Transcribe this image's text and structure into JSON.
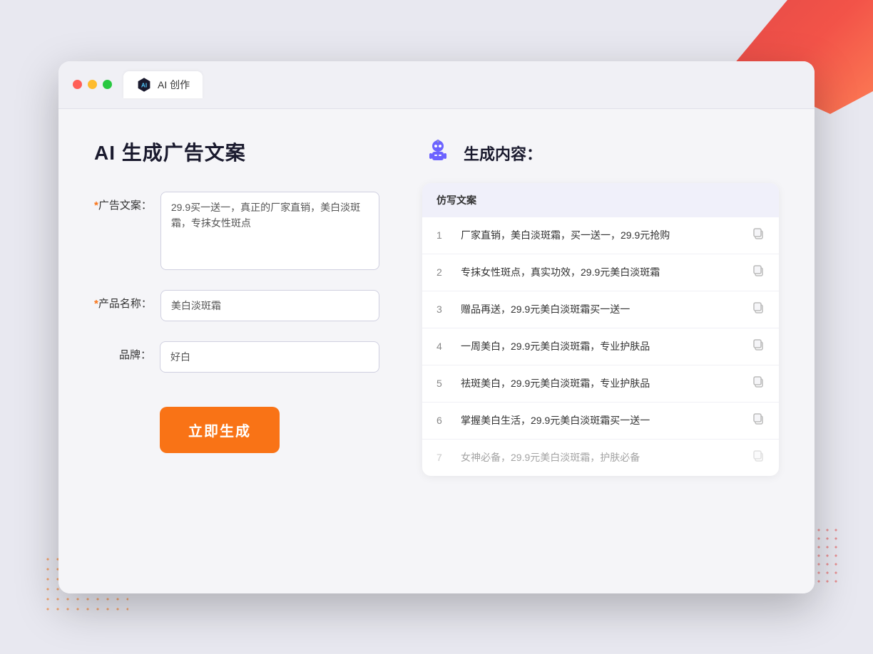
{
  "window": {
    "tab_label": "AI 创作"
  },
  "page": {
    "title": "AI 生成广告文案",
    "form": {
      "ad_copy_label": "广告文案：",
      "ad_copy_required": "*",
      "ad_copy_value": "29.9买一送一，真正的厂家直销，美白淡斑霜，专抹女性斑点",
      "product_name_label": "产品名称：",
      "product_name_required": "*",
      "product_name_value": "美白淡斑霜",
      "brand_label": "品牌：",
      "brand_value": "好白",
      "generate_button_label": "立即生成"
    },
    "output": {
      "header_title": "生成内容：",
      "column_header": "仿写文案",
      "results": [
        {
          "num": "1",
          "text": "厂家直销，美白淡斑霜，买一送一，29.9元抢购",
          "dimmed": false
        },
        {
          "num": "2",
          "text": "专抹女性斑点，真实功效，29.9元美白淡斑霜",
          "dimmed": false
        },
        {
          "num": "3",
          "text": "赠品再送，29.9元美白淡斑霜买一送一",
          "dimmed": false
        },
        {
          "num": "4",
          "text": "一周美白，29.9元美白淡斑霜，专业护肤品",
          "dimmed": false
        },
        {
          "num": "5",
          "text": "祛斑美白，29.9元美白淡斑霜，专业护肤品",
          "dimmed": false
        },
        {
          "num": "6",
          "text": "掌握美白生活，29.9元美白淡斑霜买一送一",
          "dimmed": false
        },
        {
          "num": "7",
          "text": "女神必备，29.9元美白淡斑霜，护肤必备",
          "dimmed": true
        }
      ]
    }
  }
}
